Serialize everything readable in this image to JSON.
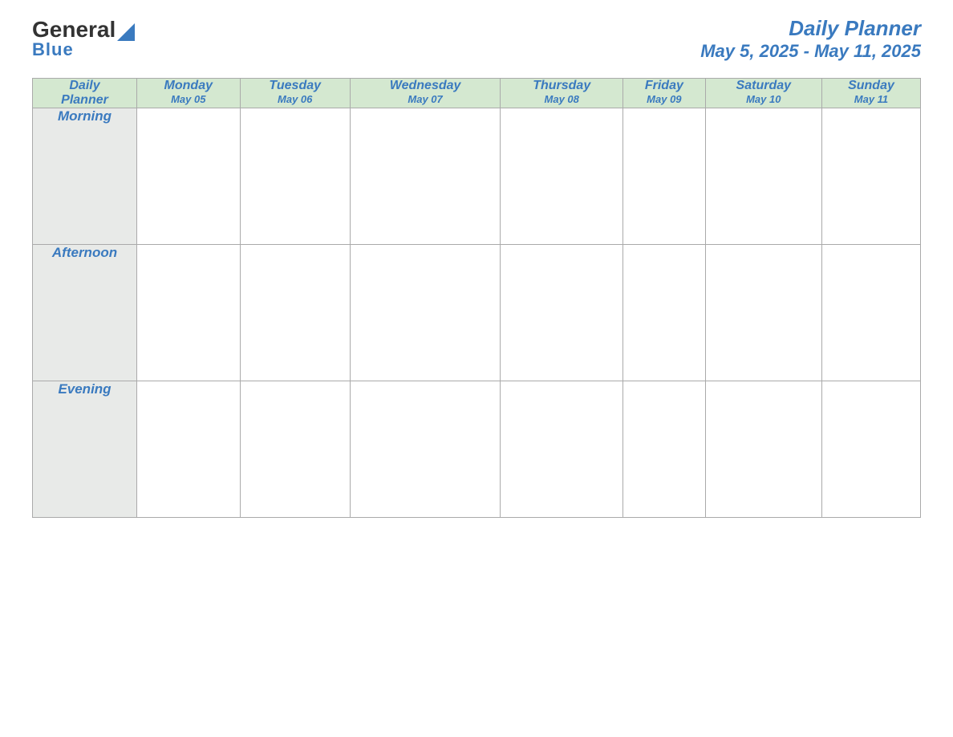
{
  "header": {
    "logo": {
      "line1": "General",
      "arrow_color": "#3a7abf",
      "line2": "Blue"
    },
    "title": "Daily Planner",
    "date_range": "May 5, 2025 - May 11, 2025"
  },
  "table": {
    "header_row": {
      "col0": {
        "name": "Daily",
        "name2": "Planner",
        "date": ""
      },
      "col1": {
        "name": "Monday",
        "date": "May 05"
      },
      "col2": {
        "name": "Tuesday",
        "date": "May 06"
      },
      "col3": {
        "name": "Wednesday",
        "date": "May 07"
      },
      "col4": {
        "name": "Thursday",
        "date": "May 08"
      },
      "col5": {
        "name": "Friday",
        "date": "May 09"
      },
      "col6": {
        "name": "Saturday",
        "date": "May 10"
      },
      "col7": {
        "name": "Sunday",
        "date": "May 11"
      }
    },
    "rows": [
      {
        "label": "Morning"
      },
      {
        "label": "Afternoon"
      },
      {
        "label": "Evening"
      }
    ]
  }
}
